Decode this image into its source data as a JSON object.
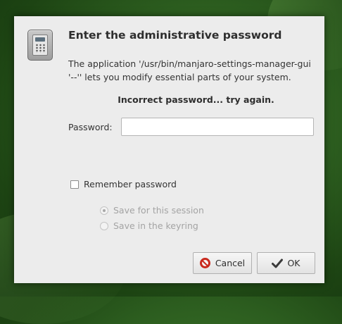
{
  "dialog": {
    "title": "Enter the administrative password",
    "message": "The application '/usr/bin/manjaro-settings-manager-gui '--'' lets you modify essential parts of your system.",
    "error": "Incorrect password... try again.",
    "password_label": "Password:",
    "password_value": "",
    "remember_label": "Remember password",
    "remember_checked": false,
    "radio_session_label": "Save for this session",
    "radio_keyring_label": "Save in the keyring",
    "cancel_label": "Cancel",
    "ok_label": "OK"
  },
  "icons": {
    "dialog_icon": "authentication-keypad-icon",
    "cancel_icon": "cancel-no-entry-icon",
    "ok_icon": "checkmark-icon"
  },
  "colors": {
    "cancel_icon": "#c92a1e",
    "dialog_bg": "#ececec"
  }
}
